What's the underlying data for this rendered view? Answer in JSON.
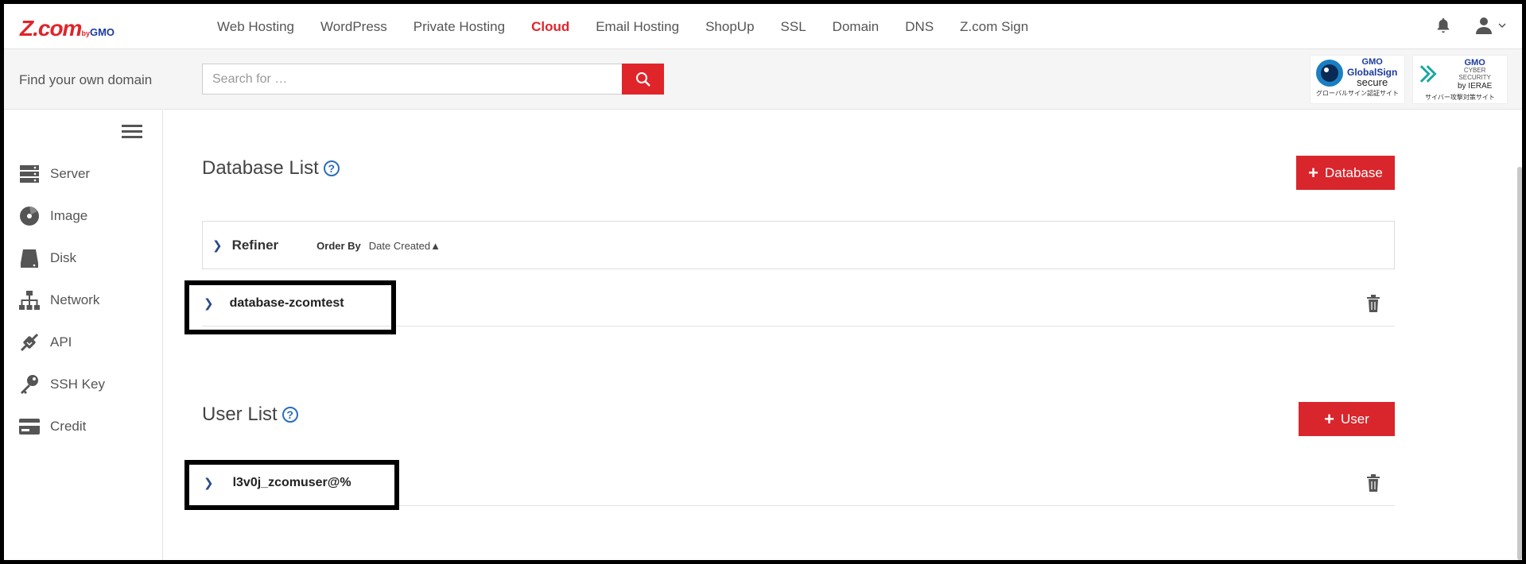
{
  "logo": {
    "main": "Z.com",
    "by": "by",
    "gmo": "GMO"
  },
  "nav": {
    "items": [
      "Web Hosting",
      "WordPress",
      "Private Hosting",
      "Cloud",
      "Email Hosting",
      "ShopUp",
      "SSL",
      "Domain",
      "DNS",
      "Z.com Sign"
    ],
    "active": "Cloud"
  },
  "search": {
    "label": "Find your own domain",
    "placeholder": "Search for …"
  },
  "badges": {
    "globalsign": {
      "gmo": "GMO",
      "name": "GlobalSign",
      "secure": "secure",
      "caption": "グローバルサイン認証サイト"
    },
    "ierae": {
      "gmo": "GMO",
      "line1": "CYBER SECURITY",
      "line2": "by IERAE",
      "caption": "サイバー攻撃対策サイト"
    }
  },
  "sidebar": {
    "items": [
      {
        "label": "Server",
        "icon": "server-icon"
      },
      {
        "label": "Image",
        "icon": "image-icon"
      },
      {
        "label": "Disk",
        "icon": "disk-icon"
      },
      {
        "label": "Network",
        "icon": "network-icon"
      },
      {
        "label": "API",
        "icon": "api-icon"
      },
      {
        "label": "SSH Key",
        "icon": "key-icon"
      },
      {
        "label": "Credit",
        "icon": "credit-card-icon"
      }
    ]
  },
  "database_section": {
    "title": "Database List",
    "add_button": "Database",
    "refiner_label": "Refiner",
    "order_by_label": "Order By",
    "order_by_value": "Date Created▲",
    "rows": [
      "database-zcomtest"
    ]
  },
  "user_section": {
    "title": "User List",
    "add_button": "User",
    "rows": [
      "l3v0j_zcomuser@%"
    ]
  },
  "colors": {
    "brand_red": "#e0252a",
    "button_red": "#d8262c",
    "chevron_blue": "#2a4a8a"
  }
}
